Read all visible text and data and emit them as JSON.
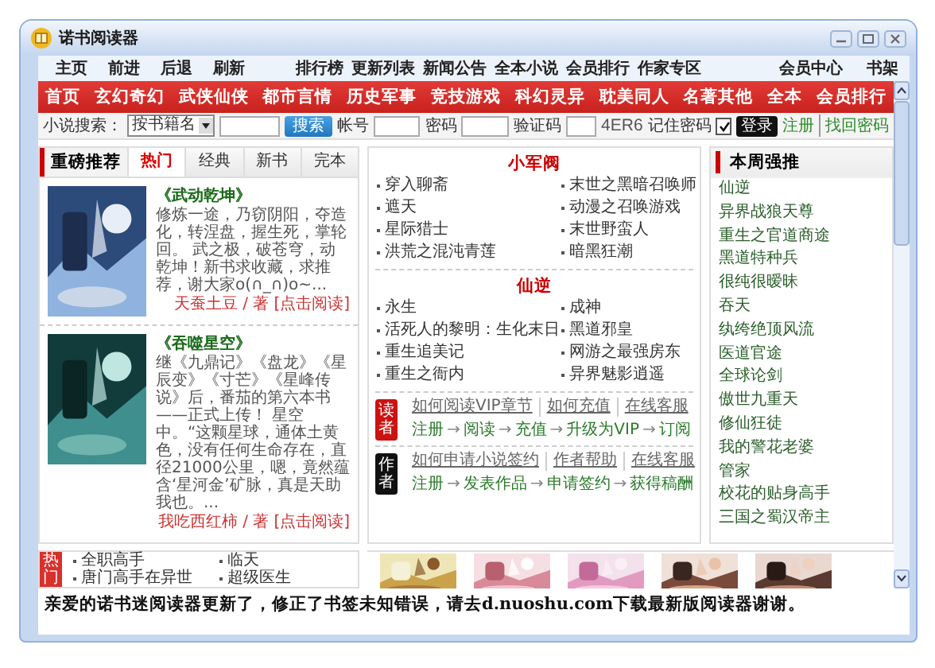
{
  "window": {
    "title": "诺书阅读器"
  },
  "top_menu": {
    "left": [
      "主页",
      "前进",
      "后退",
      "刷新"
    ],
    "middle": [
      "排行榜",
      "更新列表",
      "新闻公告",
      "全本小说",
      "会员排行",
      "作家专区"
    ],
    "right": [
      "会员中心",
      "书架"
    ]
  },
  "categories": [
    "首页",
    "玄幻奇幻",
    "武侠仙侠",
    "都市言情",
    "历史军事",
    "竞技游戏",
    "科幻灵异",
    "耽美同人",
    "名著其他",
    "全本",
    "会员排行"
  ],
  "search": {
    "label": "小说搜索：",
    "type_select": "按书籍名",
    "button": "搜索",
    "account_label": "帐号",
    "password_label": "密码",
    "captcha_label": "验证码",
    "captcha": "4ER6",
    "remember_label": "记住密码",
    "remember_checked": true,
    "login_button": "登录",
    "register_link": "注册",
    "recover_link": "找回密码"
  },
  "recommend": {
    "title": "重磅推荐",
    "tabs": [
      {
        "label": "热门",
        "selected": true
      },
      {
        "label": "经典",
        "selected": false
      },
      {
        "label": "新书",
        "selected": false
      },
      {
        "label": "完本",
        "selected": false
      }
    ],
    "books": [
      {
        "title": "《武动乾坤》",
        "cover": {
          "kind": "picture"
        },
        "description": "修炼一途，乃窃阴阳，夺造化，转涅盘，握生死，掌轮回。 武之极，破苍穹，动乾坤！新书求收藏，求推荐，谢大家o(∩_∩)o~...",
        "author": "天蚕土豆 / 著",
        "read_link": "[点击阅读]"
      },
      {
        "title": "《吞噬星空》",
        "cover": {
          "kind": "picture"
        },
        "description": "继《九鼎记》《盘龙》《星辰变》《寸芒》《星峰传说》后，番茄的第六本书——正式上传！ 星空中。“这颗星球，通体土黄色，没有任何生命存在，直径21000公里，嗯，竟然蕴含‘星河金’矿脉，真是天助我也。...",
        "author": "我吃西红柿 / 著",
        "read_link": "[点击阅读]"
      }
    ]
  },
  "featured": {
    "sections": [
      {
        "title": "小军阀",
        "items": [
          "穿入聊斋",
          "末世之黑暗召唤师",
          "遮天",
          "动漫之召唤游戏",
          "星际猎士",
          "末世野蛮人",
          "洪荒之混沌青莲",
          "暗黑狂潮"
        ]
      },
      {
        "title": "仙逆",
        "items": [
          "永生",
          "成神",
          "活死人的黎明：生化末日",
          "黑道邪皇",
          "重生追美记",
          "网游之最强房东",
          "重生之衙内",
          "异界魅影逍遥"
        ]
      }
    ],
    "guides": [
      {
        "badge": "读者",
        "color": "#cc1111",
        "links": [
          "如何阅读VIP章节",
          "如何充值",
          "在线客服"
        ],
        "steps": [
          "注册",
          "阅读",
          "充值",
          "升级为VIP",
          "订阅"
        ],
        "arrow": "→"
      },
      {
        "badge": "作者",
        "color": "#111111",
        "links": [
          "如何申请小说签约",
          "作者帮助",
          "在线客服"
        ],
        "steps": [
          "注册",
          "发表作品",
          "申请签约",
          "获得稿酬"
        ],
        "arrow": "→"
      }
    ]
  },
  "weekly": {
    "title": "本周强推",
    "items": [
      "仙逆",
      "异界战狼天尊",
      "重生之官道商途",
      "黑道特种兵",
      "很纯很暧昧",
      "吞天",
      "纨绔绝顶风流",
      "医道官途",
      "全球论剑",
      "傲世九重天",
      "修仙狂徒",
      "我的警花老婆",
      "管家",
      "校花的贴身高手",
      "三国之蜀汉帝主"
    ]
  },
  "bottom": {
    "badge": "热门",
    "items": [
      "全职高手",
      "临天",
      "唐门高手在异世",
      "超级医生"
    ],
    "thumbnails": [
      {
        "kind": "picture"
      },
      {
        "kind": "picture"
      },
      {
        "kind": "picture"
      },
      {
        "kind": "picture"
      },
      {
        "kind": "picture"
      }
    ]
  },
  "message": "亲爱的诺书迷阅读器更新了，修正了书签未知错误，请去d.nuoshu.com下载最新版阅读器谢谢。"
}
